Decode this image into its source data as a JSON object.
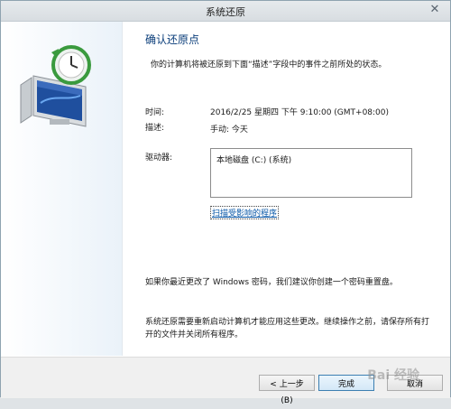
{
  "window": {
    "title": "系统还原",
    "close_glyph": "✕"
  },
  "content": {
    "heading": "确认还原点",
    "intro": "你的计算机将被还原到下面“描述”字段中的事件之前所处的状态。",
    "time_label": "时间:",
    "time_value": "2016/2/25 星期四 下午 9:10:00 (GMT+08:00)",
    "desc_label": "描述:",
    "desc_value": "手动: 今天",
    "drive_label": "驱动器:",
    "drives": [
      "本地磁盘 (C:) (系统)"
    ],
    "scan_link": "扫描受影响的程序",
    "note_password": "如果你最近更改了 Windows 密码，我们建议你创建一个密码重置盘。",
    "note_restart": "系统还原需要重新启动计算机才能应用这些更改。继续操作之前，请保存所有打开的文件并关闭所有程序。"
  },
  "footer": {
    "back_label": "< 上一步(B)",
    "finish_label": "完成",
    "cancel_label": "取消"
  },
  "watermark": "Bai 经验",
  "icons": {
    "left": "system-restore-monitor-clock-icon",
    "close": "close-icon"
  },
  "colors": {
    "heading": "#0a3d7a",
    "link": "#0a58a8",
    "accent_border": "#3c7fb1"
  }
}
